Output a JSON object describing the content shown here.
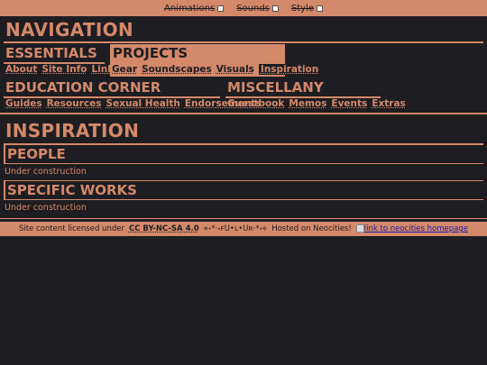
{
  "topbar": {
    "options": [
      {
        "label": "Animations"
      },
      {
        "label": "Sounds"
      },
      {
        "label": "Style"
      }
    ]
  },
  "nav": {
    "title": "NAVIGATION",
    "essentials": {
      "title": "ESSENTIALS",
      "links": [
        "About",
        "Site Info",
        "Links"
      ]
    },
    "projects": {
      "title": "PROJECTS",
      "links": [
        "Gear",
        "Soundscapes",
        "Visuals",
        "Inspiration"
      ]
    },
    "education": {
      "title": "EDUCATION CORNER",
      "links": [
        "Guides",
        "Resources",
        "Sexual Health",
        "Endorsements"
      ]
    },
    "misc": {
      "title": "MISCELLANY",
      "links": [
        "Guestbook",
        "Memos",
        "Events",
        "Extras"
      ]
    }
  },
  "main": {
    "title": "INSPIRATION",
    "sections": [
      {
        "title": "PEOPLE",
        "body": "Under construction"
      },
      {
        "title": "SPECIFIC WORKS",
        "body": "Under construction"
      }
    ]
  },
  "footer": {
    "pre": "Site content licensed under",
    "license": "CC BY-NC-SA 4.0",
    "deco": "⋄˖*·˖ꜰU•ʟ•Uʀ·*˖⋄",
    "hosted": "Hosted on Neocities!",
    "link": "link to neocities homepage"
  },
  "colors": {
    "accent": "#d4896a",
    "background": "#1e1d22"
  }
}
